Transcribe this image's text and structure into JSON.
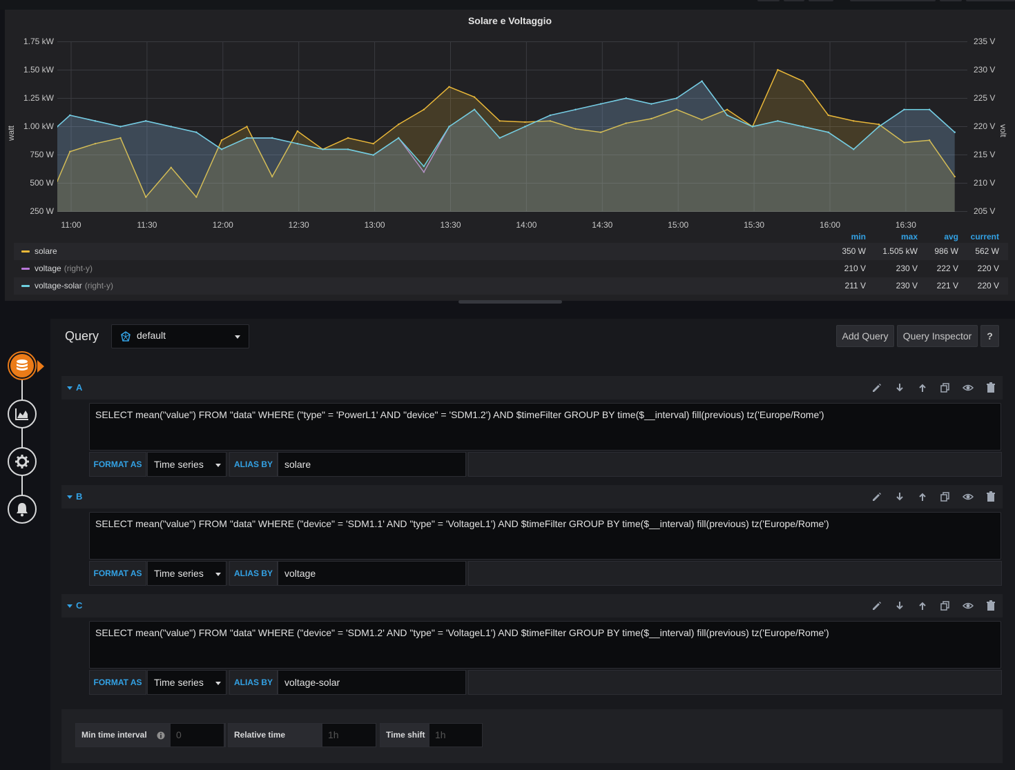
{
  "panel": {
    "title": "Solare e Voltaggio",
    "y_left_label": "watt",
    "y_right_label": "volt",
    "y_left_ticks": [
      "1.75 kW",
      "1.50 kW",
      "1.25 kW",
      "1.00 kW",
      "750 W",
      "500 W",
      "250 W"
    ],
    "y_right_ticks": [
      "235 V",
      "230 V",
      "225 V",
      "220 V",
      "215 V",
      "210 V",
      "205 V"
    ],
    "x_ticks": [
      "11:00",
      "11:30",
      "12:00",
      "12:30",
      "13:00",
      "13:30",
      "14:00",
      "14:30",
      "15:00",
      "15:30",
      "16:00",
      "16:30"
    ]
  },
  "chart_data": {
    "type": "area",
    "title": "Solare e Voltaggio",
    "ylabel_left": "watt",
    "ylabel_right": "volt",
    "ylim_left": [
      250,
      1750
    ],
    "ylim_right": [
      205,
      235
    ],
    "x": [
      "10:55",
      "11:00",
      "11:10",
      "11:20",
      "11:30",
      "11:40",
      "11:50",
      "12:00",
      "12:10",
      "12:20",
      "12:30",
      "12:40",
      "12:50",
      "13:00",
      "13:10",
      "13:20",
      "13:30",
      "13:40",
      "13:50",
      "14:00",
      "14:10",
      "14:20",
      "14:30",
      "14:40",
      "14:50",
      "15:00",
      "15:10",
      "15:20",
      "15:30",
      "15:40",
      "15:50",
      "16:00",
      "16:10",
      "16:20",
      "16:30",
      "16:40",
      "16:50"
    ],
    "series": [
      {
        "name": "solare",
        "axis": "left",
        "color": "#eab839",
        "values": [
          520,
          780,
          850,
          900,
          380,
          640,
          380,
          880,
          1000,
          560,
          960,
          800,
          900,
          850,
          1020,
          1150,
          1350,
          1260,
          1050,
          1040,
          1050,
          980,
          950,
          1030,
          1070,
          1150,
          1060,
          1150,
          1000,
          1500,
          1400,
          1100,
          1050,
          1020,
          860,
          880,
          560
        ]
      },
      {
        "name": "voltage",
        "axis": "right",
        "color": "#b877d9",
        "values": [
          220,
          222,
          221,
          220,
          221,
          220,
          219,
          216,
          218,
          218,
          217,
          216,
          216,
          215,
          218,
          212,
          220,
          223,
          218,
          220,
          222,
          223,
          224,
          225,
          224,
          225,
          228,
          222,
          220,
          221,
          220,
          219,
          216,
          220,
          223,
          223,
          219
        ]
      },
      {
        "name": "voltage-solar",
        "axis": "right",
        "color": "#6ed0e0",
        "values": [
          220,
          222,
          221,
          220,
          221,
          220,
          219,
          216,
          218,
          218,
          217,
          216,
          216,
          215,
          218,
          213,
          220,
          223,
          218,
          220,
          222,
          223,
          224,
          225,
          224,
          225,
          228,
          222,
          220,
          221,
          220,
          219,
          216,
          220,
          223,
          223,
          219
        ]
      }
    ],
    "grid": true,
    "legend_placement": "bottom"
  },
  "legend": {
    "headers": [
      "min",
      "max",
      "avg",
      "current"
    ],
    "rows": [
      {
        "name": "solare",
        "axis": "",
        "color": "#eab839",
        "min": "350 W",
        "max": "1.505 kW",
        "avg": "986 W",
        "current": "562 W"
      },
      {
        "name": "voltage",
        "axis": "(right-y)",
        "color": "#b877d9",
        "min": "210 V",
        "max": "230 V",
        "avg": "222 V",
        "current": "220 V"
      },
      {
        "name": "voltage-solar",
        "axis": "(right-y)",
        "color": "#6ed0e0",
        "min": "211 V",
        "max": "230 V",
        "avg": "221 V",
        "current": "220 V"
      }
    ]
  },
  "editor": {
    "query_label": "Query",
    "datasource": "default",
    "add_query": "Add Query",
    "query_inspector": "Query Inspector",
    "help": "?",
    "format_as_label": "FORMAT AS",
    "alias_by_label": "ALIAS BY",
    "queries": [
      {
        "ref": "A",
        "sql": "SELECT mean(\"value\") FROM \"data\" WHERE (\"type\" = 'PowerL1' AND \"device\" = 'SDM1.2') AND $timeFilter GROUP BY time($__interval) fill(previous) tz('Europe/Rome')",
        "format": "Time series",
        "alias": "solare"
      },
      {
        "ref": "B",
        "sql": "SELECT mean(\"value\") FROM \"data\" WHERE (\"device\" = 'SDM1.1' AND \"type\" = 'VoltageL1') AND $timeFilter GROUP BY time($__interval) fill(previous) tz('Europe/Rome')",
        "format": "Time series",
        "alias": "voltage"
      },
      {
        "ref": "C",
        "sql": "SELECT mean(\"value\") FROM \"data\" WHERE (\"device\" = 'SDM1.2' AND \"type\" = 'VoltageL1') AND $timeFilter GROUP BY time($__interval) fill(previous) tz('Europe/Rome')",
        "format": "Time series",
        "alias": "voltage-solar"
      }
    ],
    "options": {
      "min_interval_label": "Min time interval",
      "min_interval_placeholder": "0",
      "relative_time_label": "Relative time",
      "relative_time_placeholder": "1h",
      "time_shift_label": "Time shift",
      "time_shift_placeholder": "1h"
    }
  },
  "sidebar": {
    "steps": [
      "database-icon",
      "chart-area-icon",
      "gear-icon",
      "bell-icon"
    ]
  }
}
